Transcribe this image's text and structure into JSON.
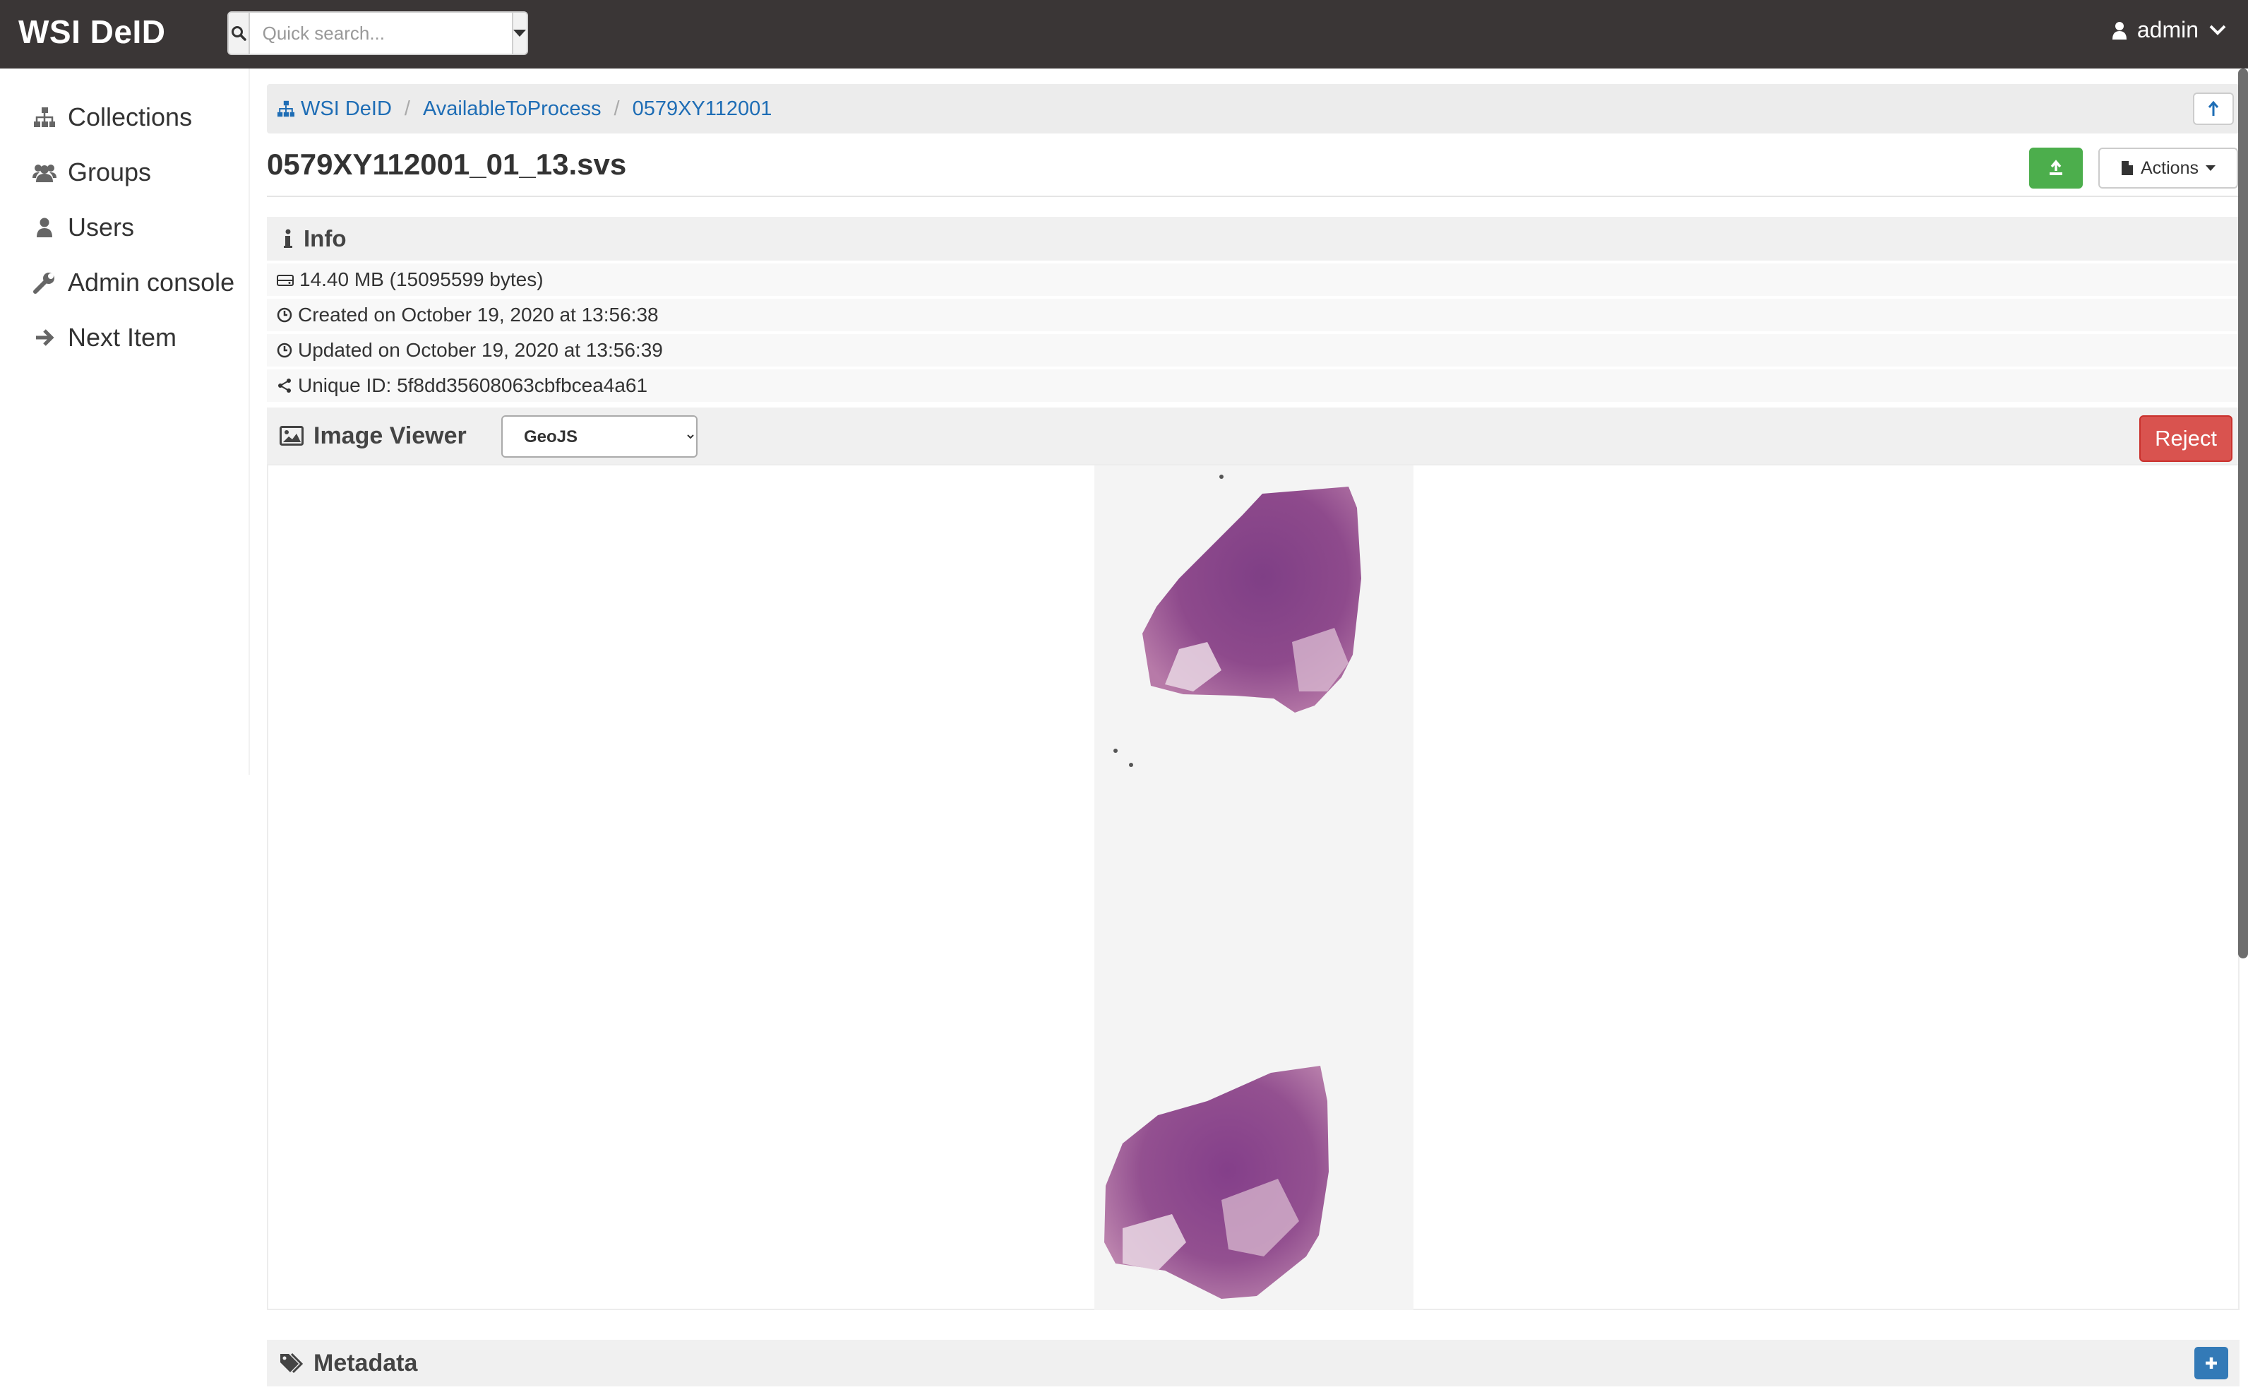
{
  "header": {
    "brand": "WSI DeID",
    "search_placeholder": "Quick search...",
    "user": "admin"
  },
  "sidebar": {
    "items": [
      {
        "label": "Collections",
        "icon": "sitemap-icon"
      },
      {
        "label": "Groups",
        "icon": "users-icon"
      },
      {
        "label": "Users",
        "icon": "user-icon"
      },
      {
        "label": "Admin console",
        "icon": "wrench-icon"
      },
      {
        "label": "Next Item",
        "icon": "arrow-right-icon"
      }
    ]
  },
  "breadcrumb": [
    "WSI DeID",
    "AvailableToProcess",
    "0579XY112001"
  ],
  "item": {
    "title": "0579XY112001_01_13.svs",
    "actions_label": "Actions"
  },
  "info": {
    "heading": "Info",
    "size": "14.40 MB (15095599 bytes)",
    "created": "Created on October 19, 2020 at 13:56:38",
    "updated": "Updated on October 19, 2020 at 13:56:39",
    "unique_id": "Unique ID: 5f8dd35608063cbfbcea4a61"
  },
  "viewer": {
    "heading": "Image Viewer",
    "selected": "GeoJS",
    "reject_label": "Reject"
  },
  "metadata": {
    "heading": "Metadata"
  },
  "colors": {
    "topbar": "#3a3636",
    "link": "#1e6db5",
    "success": "#4cae4c",
    "danger": "#d9534f",
    "primary": "#337ab7",
    "tissue": "#8e4a8c"
  }
}
